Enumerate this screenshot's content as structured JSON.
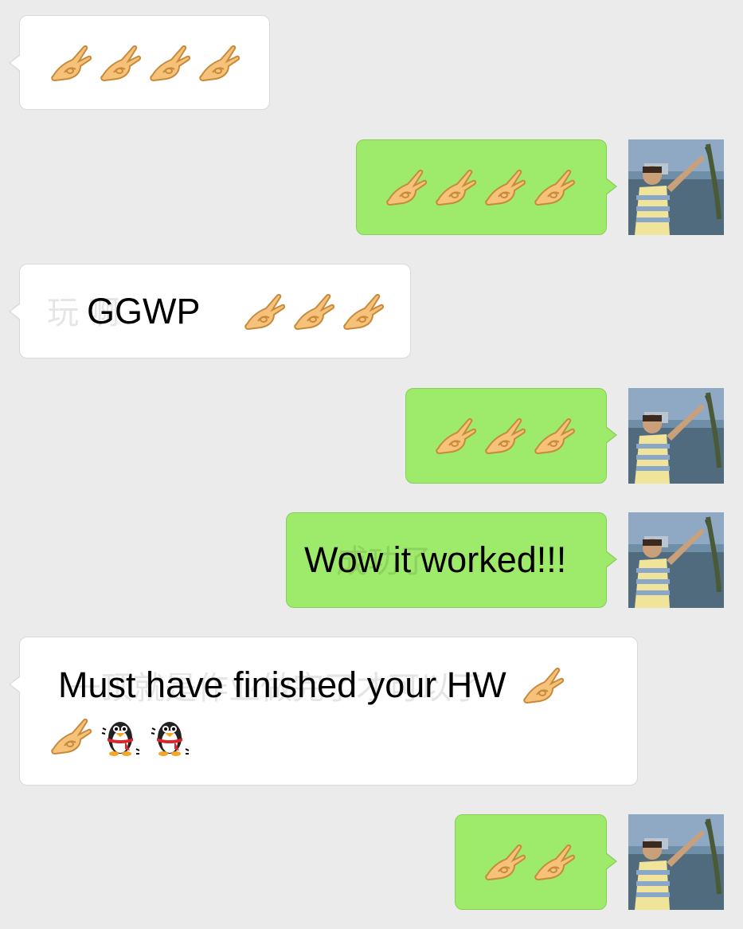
{
  "app": {
    "accent_outgoing": "#9eea6a",
    "accent_incoming": "#ffffff",
    "background": "#ebebeb"
  },
  "messages": [
    {
      "direction": "incoming",
      "text": "",
      "emojis": [
        "ok-hand-emoji",
        "ok-hand-emoji",
        "ok-hand-emoji",
        "ok-hand-emoji"
      ]
    },
    {
      "direction": "outgoing",
      "text": "",
      "emojis": [
        "ok-hand-emoji",
        "ok-hand-emoji",
        "ok-hand-emoji",
        "ok-hand-emoji"
      ]
    },
    {
      "direction": "incoming",
      "text": "GGWP",
      "ghost_text": "玩 啊",
      "emojis_after": [
        "ok-hand-emoji",
        "ok-hand-emoji",
        "ok-hand-emoji"
      ]
    },
    {
      "direction": "outgoing",
      "text": "",
      "emojis": [
        "ok-hand-emoji",
        "ok-hand-emoji",
        "ok-hand-emoji"
      ]
    },
    {
      "direction": "outgoing",
      "text": "Wow it worked!!!",
      "ghost_text": "成功了"
    },
    {
      "direction": "incoming",
      "text": "Must have finished your HW",
      "ghost_text": "一顶就是作业做完了才可以了",
      "emojis_after": [
        "ok-hand-emoji"
      ],
      "emojis_line2": [
        "ok-hand-emoji",
        "penguin-emoji",
        "penguin-emoji"
      ]
    },
    {
      "direction": "outgoing",
      "text": "",
      "emojis": [
        "ok-hand-emoji",
        "ok-hand-emoji"
      ]
    }
  ],
  "avatar": {
    "icon": "user-avatar-photo",
    "colors": [
      "#6b8fb8",
      "#eadb6a",
      "#3d5f4a"
    ]
  }
}
